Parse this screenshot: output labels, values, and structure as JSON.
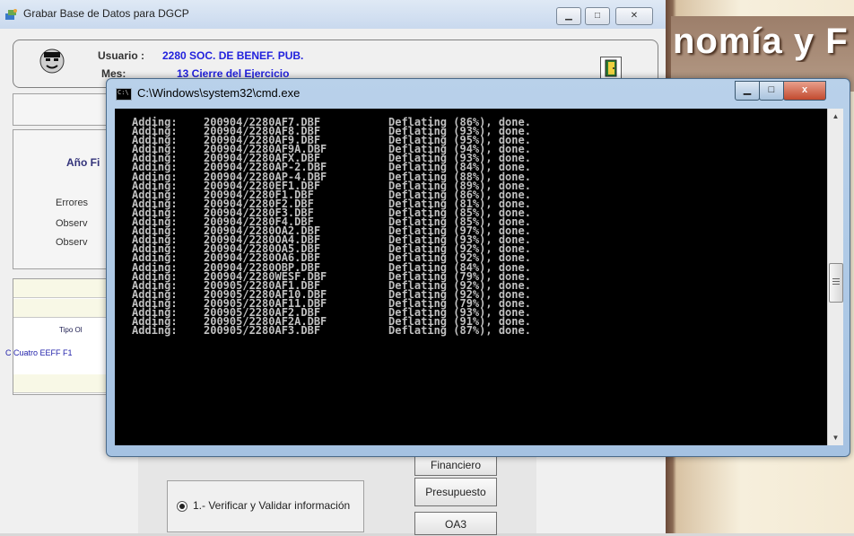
{
  "app": {
    "title": "Grabar  Base de Datos para DGCP",
    "window_controls": {
      "minimize": "▁",
      "maximize": "□",
      "close": "✕"
    },
    "user_panel": {
      "usuario_label": "Usuario :",
      "usuario_value": "2280 SOC. DE BENEF. PUB.",
      "mes_label": "Mes:",
      "mes_value": "13 Cierre del Ejercicio"
    },
    "left_labels": {
      "anio": "Año Fi",
      "errores": "Errores",
      "observ1": "Observ",
      "observ2": "Observ",
      "tipo": "Tipo Ol",
      "cuatro": "C Cuatro EEFF F1"
    },
    "buttons": {
      "financiero": "Financiero",
      "presupuesto": "Presupuesto",
      "oa3": "OA3"
    },
    "verify_option": "1.- Verificar y Validar información"
  },
  "background_image": {
    "text": "nomía y F"
  },
  "cmd": {
    "title": "C:\\Windows\\system32\\cmd.exe",
    "icon_text": "C:\\",
    "controls": {
      "minimize": "▁",
      "maximize": "□",
      "close": "x"
    },
    "scroll": {
      "up": "▲",
      "down": "▼"
    },
    "lines": [
      [
        "Adding:",
        "200904/2280AF7.DBF",
        "Deflating (86%), done."
      ],
      [
        "Adding:",
        "200904/2280AF8.DBF",
        "Deflating (93%), done."
      ],
      [
        "Adding:",
        "200904/2280AF9.DBF",
        "Deflating (95%), done."
      ],
      [
        "Adding:",
        "200904/2280AF9A.DBF",
        "Deflating (94%), done."
      ],
      [
        "Adding:",
        "200904/2280AFX.DBF",
        "Deflating (93%), done."
      ],
      [
        "Adding:",
        "200904/2280AP-2.DBF",
        "Deflating (84%), done."
      ],
      [
        "Adding:",
        "200904/2280AP-4.DBF",
        "Deflating (88%), done."
      ],
      [
        "Adding:",
        "200904/2280EF1.DBF",
        "Deflating (89%), done."
      ],
      [
        "Adding:",
        "200904/2280F1.DBF",
        "Deflating (86%), done."
      ],
      [
        "Adding:",
        "200904/2280F2.DBF",
        "Deflating (81%), done."
      ],
      [
        "Adding:",
        "200904/2280F3.DBF",
        "Deflating (85%), done."
      ],
      [
        "Adding:",
        "200904/2280F4.DBF",
        "Deflating (85%), done."
      ],
      [
        "Adding:",
        "200904/2280OA2.DBF",
        "Deflating (97%), done."
      ],
      [
        "Adding:",
        "200904/2280OA4.DBF",
        "Deflating (93%), done."
      ],
      [
        "Adding:",
        "200904/2280OA5.DBF",
        "Deflating (92%), done."
      ],
      [
        "Adding:",
        "200904/2280OA6.DBF",
        "Deflating (92%), done."
      ],
      [
        "Adding:",
        "200904/2280OBP.DBF",
        "Deflating (84%), done."
      ],
      [
        "Adding:",
        "200904/2280WESF.DBF",
        "Deflating (79%), done."
      ],
      [
        "Adding:",
        "200905/2280AF1.DBF",
        "Deflating (92%), done."
      ],
      [
        "Adding:",
        "200905/2280AF10.DBF",
        "Deflating (92%), done."
      ],
      [
        "Adding:",
        "200905/2280AF11.DBF",
        "Deflating (79%), done."
      ],
      [
        "Adding:",
        "200905/2280AF2.DBF",
        "Deflating (93%), done."
      ],
      [
        "Adding:",
        "200905/2280AF2A.DBF",
        "Deflating (91%), done."
      ],
      [
        "Adding:",
        "200905/2280AF3.DBF",
        "Deflating (87%), done."
      ]
    ]
  }
}
